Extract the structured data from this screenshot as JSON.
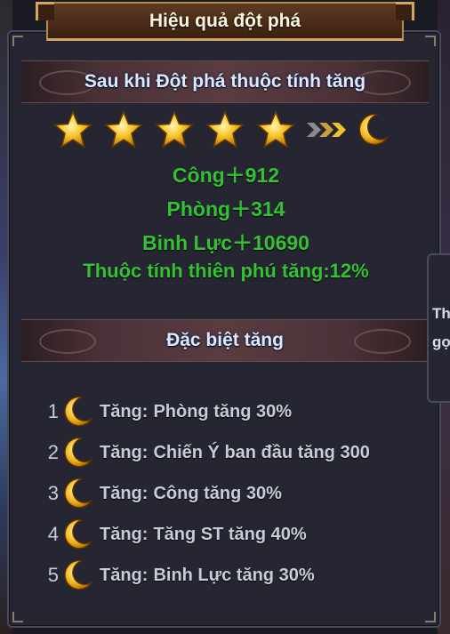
{
  "title": "Hiệu quả đột phá",
  "section_breakthrough": {
    "header": "Sau khi Đột phá thuộc tính tăng",
    "stars_filled": 5,
    "result_icon": "moon-icon",
    "stats": [
      "Công＋912",
      "Phòng＋314",
      "Binh Lực＋10690",
      "Thuộc tính thiên phú tăng:12%"
    ]
  },
  "section_special": {
    "header": "Đặc biệt tăng",
    "items": [
      {
        "num": "1",
        "label": "Tăng:",
        "text": "Phòng tăng 30%"
      },
      {
        "num": "2",
        "label": "Tăng:",
        "text": "Chiến Ý ban đầu tăng 300"
      },
      {
        "num": "3",
        "label": "Tăng:",
        "text": "Công tăng 30%"
      },
      {
        "num": "4",
        "label": "Tăng:",
        "text": "Tăng ST tăng 40%"
      },
      {
        "num": "5",
        "label": "Tăng:",
        "text": "Binh Lực tăng 30%"
      }
    ]
  },
  "side_tab": {
    "line1": "Thu",
    "line2": "gọn"
  },
  "colors": {
    "stat_green": "#34c234",
    "header_text": "#dce9ff",
    "panel_bg": "#262633",
    "gold": "#f2b51c"
  }
}
